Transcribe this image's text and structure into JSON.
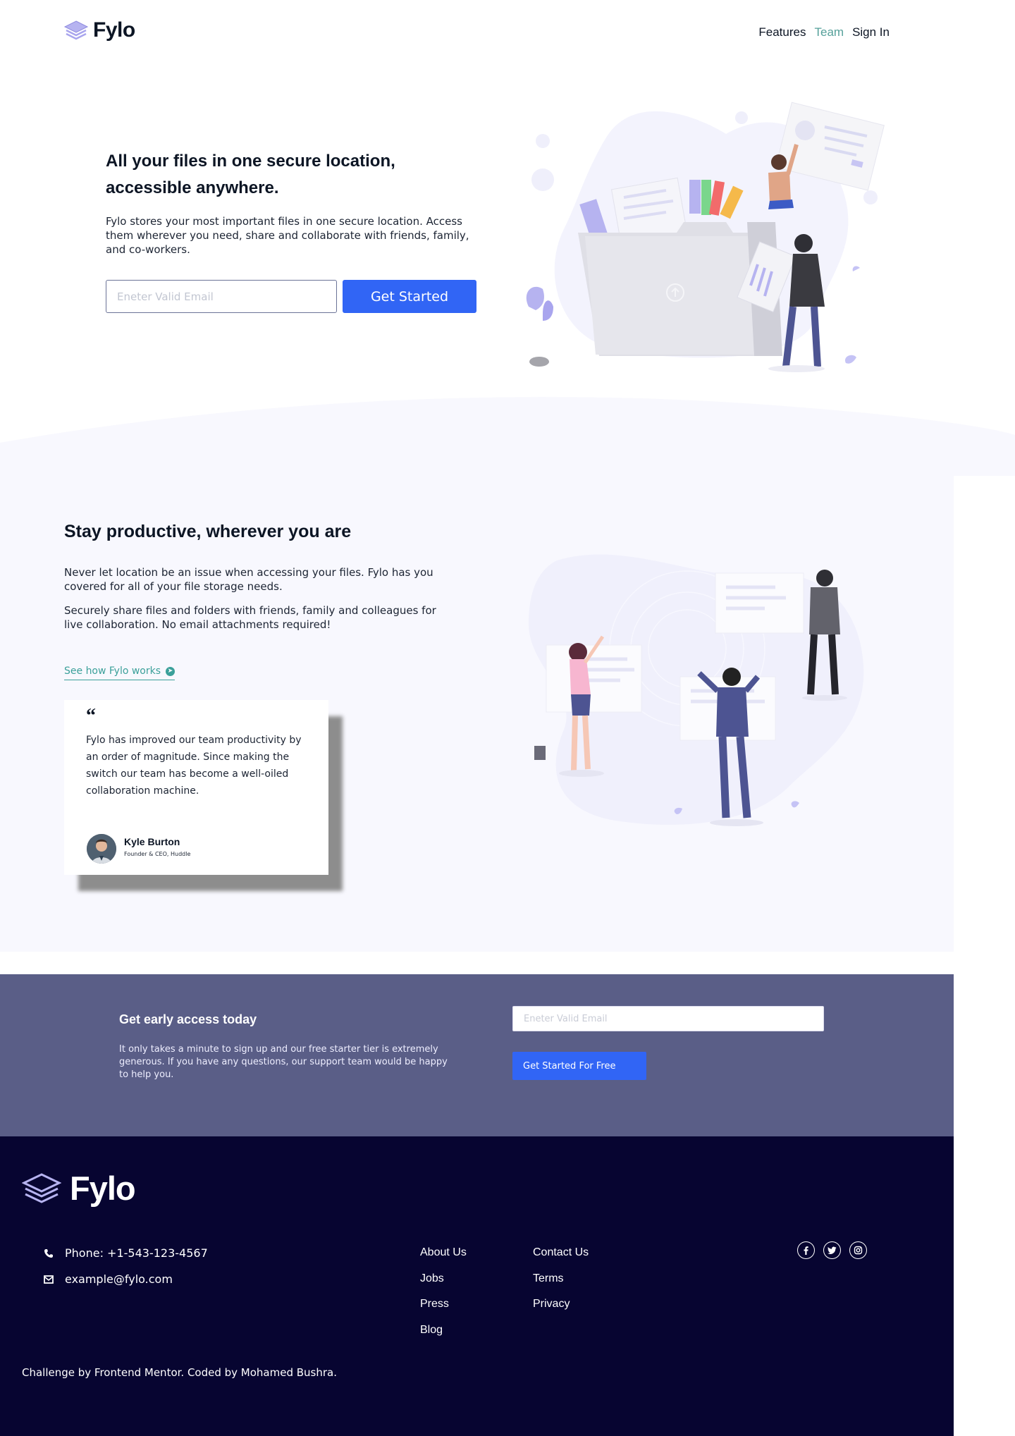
{
  "header": {
    "logo_text": "Fylo",
    "nav": [
      {
        "label": "Features"
      },
      {
        "label": "Team"
      },
      {
        "label": "Sign In"
      }
    ]
  },
  "hero": {
    "title": "All your files in one secure location, accessible anywhere.",
    "description": "Fylo stores your most important files in one secure location. Access them wherever you need, share and collaborate with friends, family, and co-workers.",
    "email_placeholder": "Eneter Valid Email",
    "cta_label": "Get Started"
  },
  "productive": {
    "title": "Stay productive, wherever you are",
    "p1": "Never let location be an issue when accessing your files. Fylo has you covered for all of your file storage needs.",
    "p2": "Securely share files and folders with friends, family and colleagues for live collaboration. No email attachments required!",
    "link_label": "See how Fylo works"
  },
  "testimonial": {
    "quote_mark": "“",
    "text": "Fylo has improved our team productivity by an order of magnitude. Since making the switch our team has become a well-oiled collaboration machine.",
    "name": "Kyle Burton",
    "role": "Founder & CEO, Huddle"
  },
  "early_access": {
    "title": "Get early access today",
    "description": "It only takes a minute to sign up and our free starter tier is extremely generous. If you have any questions, our support team would be happy to help you.",
    "email_placeholder": "Eneter Valid Email",
    "cta_label": "Get Started For Free"
  },
  "footer": {
    "logo_text": "Fylo",
    "phone": "Phone: +1-543-123-4567",
    "email": "example@fylo.com",
    "links_col1": [
      "About Us",
      "Jobs",
      "Press",
      "Blog"
    ],
    "links_col2": [
      "Contact Us",
      "Terms",
      "Privacy"
    ],
    "social": [
      "facebook-icon",
      "twitter-icon",
      "instagram-icon"
    ],
    "credit": "Challenge by Frontend Mentor. Coded by Mohamed Bushra."
  },
  "colors": {
    "brand_blue": "#3165f5",
    "nav_active": "#55a09a",
    "cta_bg": "#5a5e87",
    "footer_bg": "#070531"
  }
}
